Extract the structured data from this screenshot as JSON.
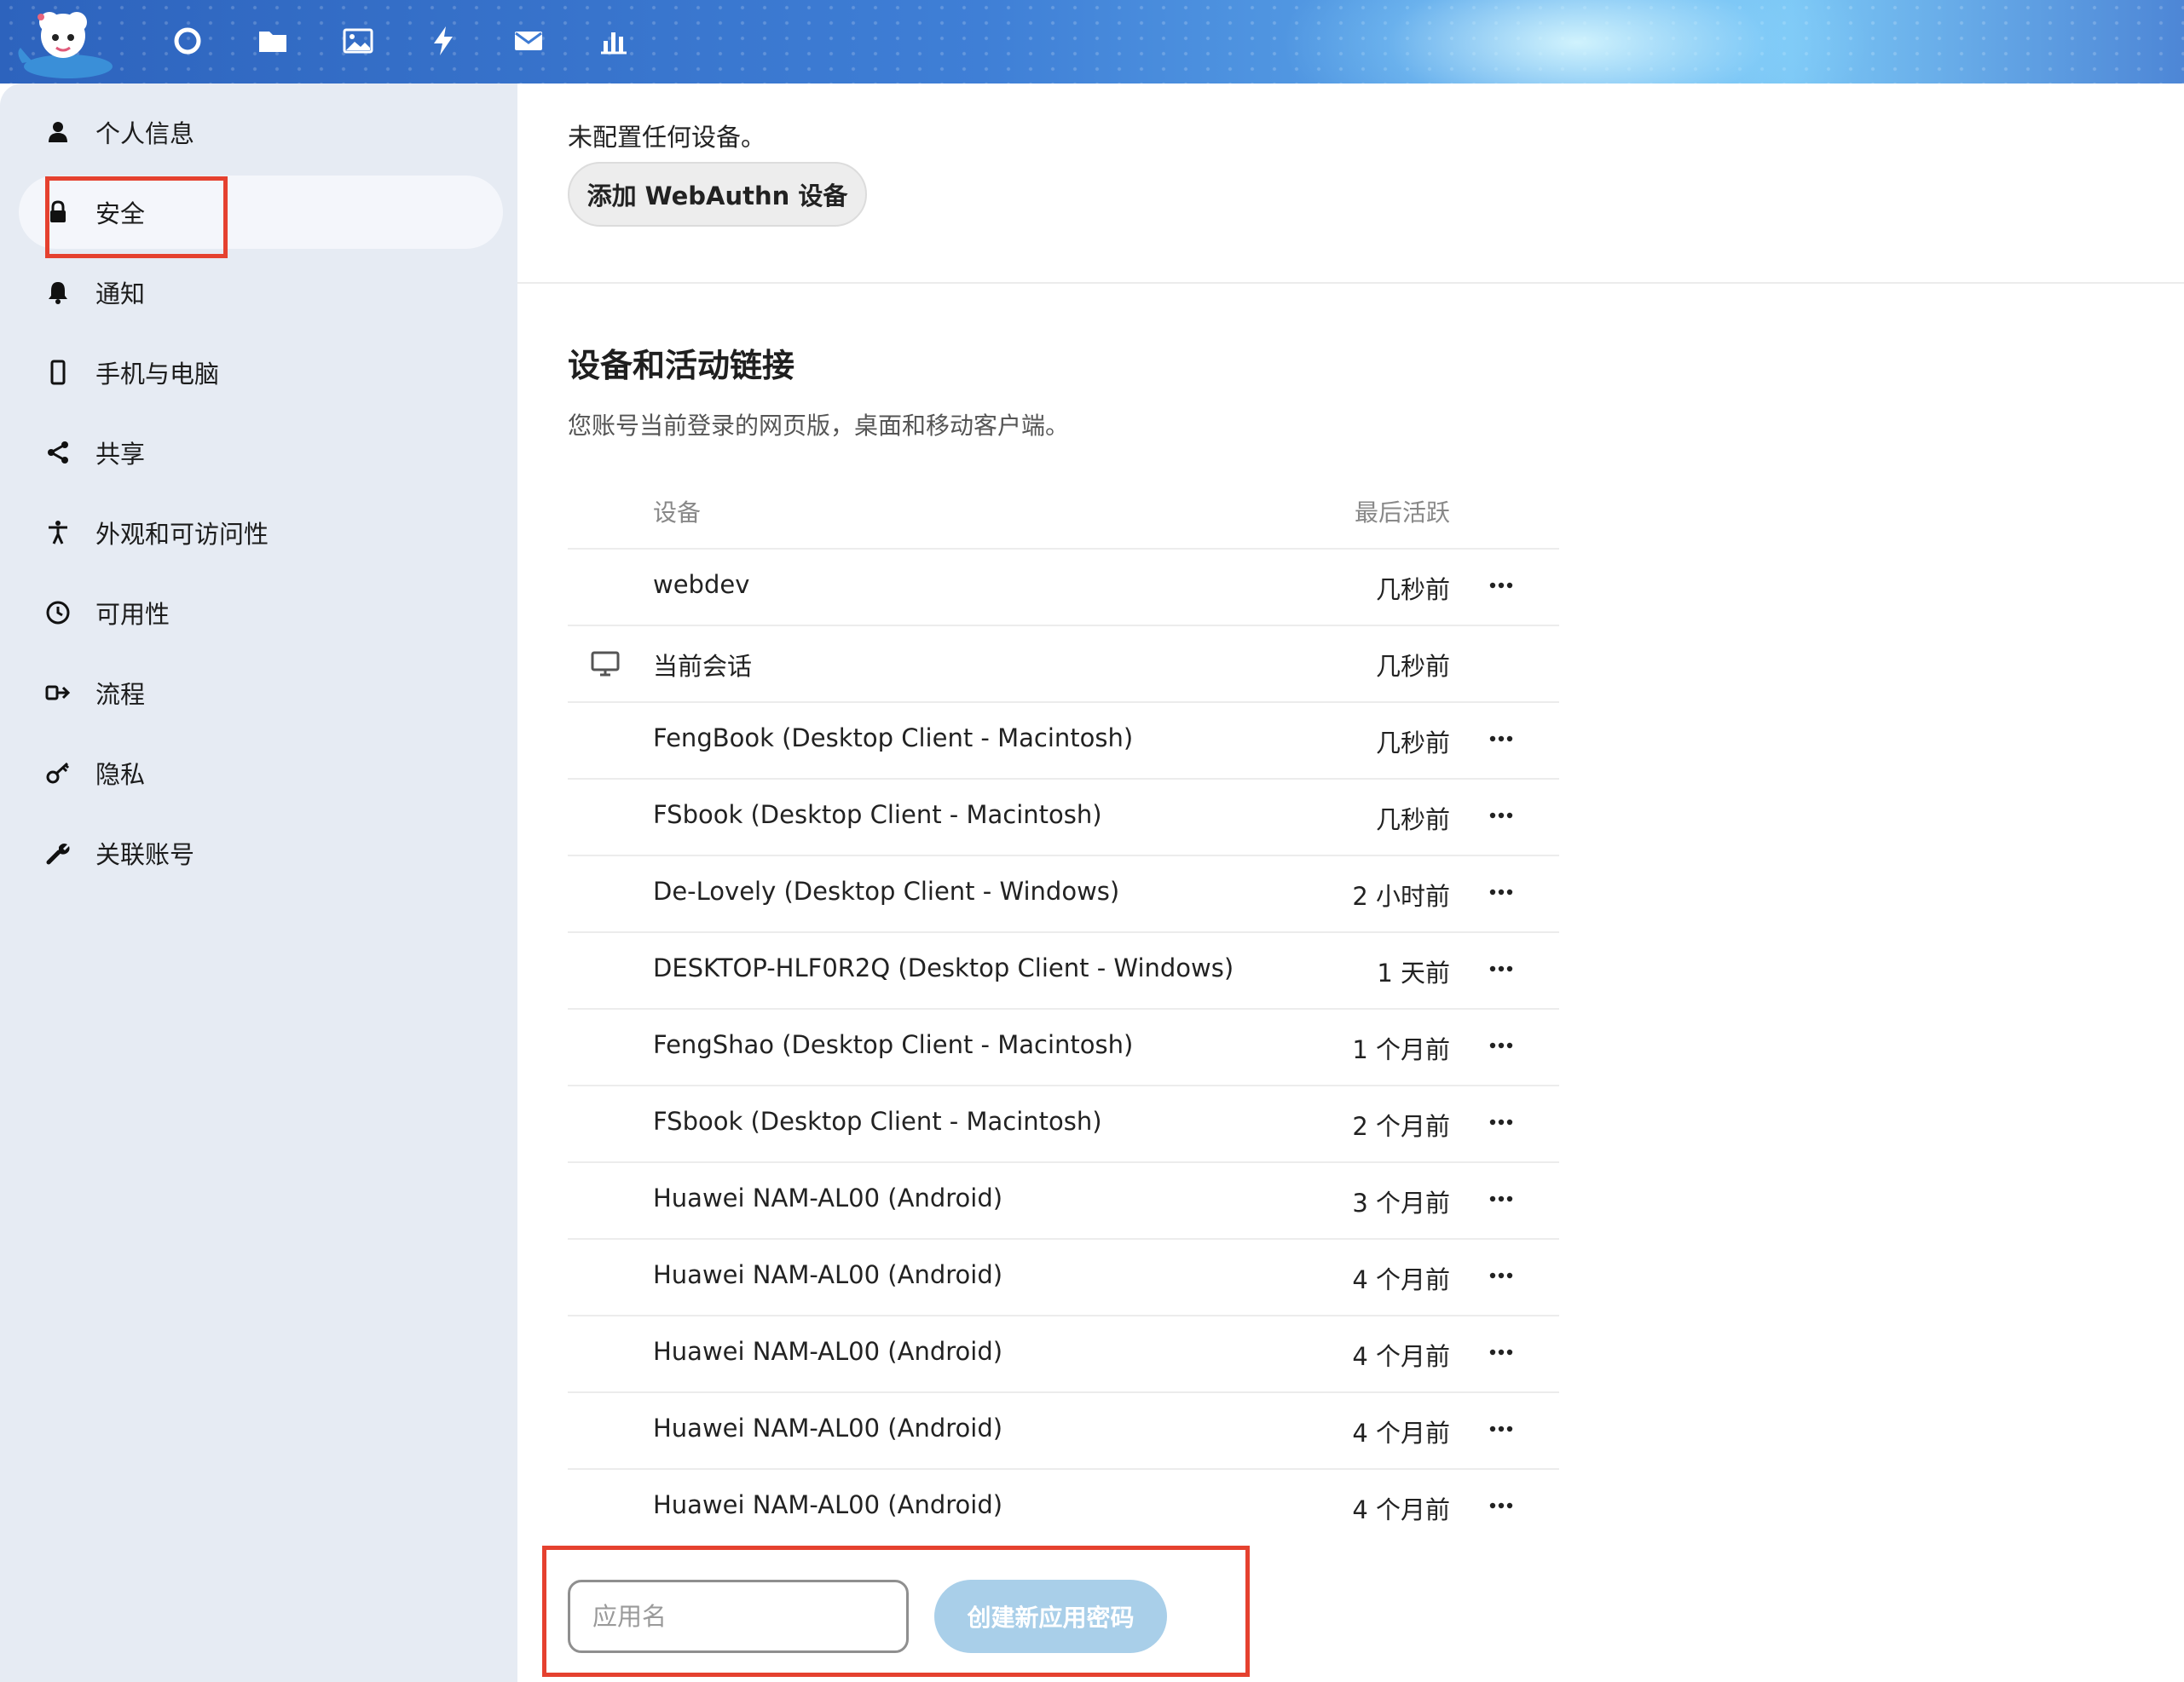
{
  "header": {
    "apps": [
      {
        "name": "dashboard",
        "icon": "circle-icon"
      },
      {
        "name": "files",
        "icon": "folder-icon"
      },
      {
        "name": "photos",
        "icon": "image-icon"
      },
      {
        "name": "activity",
        "icon": "bolt-icon"
      },
      {
        "name": "mail",
        "icon": "mail-icon"
      },
      {
        "name": "analytics",
        "icon": "bar-chart-icon"
      }
    ]
  },
  "sidebar": {
    "items": [
      {
        "label": "个人信息",
        "icon": "user-icon"
      },
      {
        "label": "安全",
        "icon": "lock-icon",
        "active": true
      },
      {
        "label": "通知",
        "icon": "bell-icon"
      },
      {
        "label": "手机与电脑",
        "icon": "phone-icon"
      },
      {
        "label": "共享",
        "icon": "share-icon"
      },
      {
        "label": "外观和可访问性",
        "icon": "accessibility-icon"
      },
      {
        "label": "可用性",
        "icon": "clock-icon"
      },
      {
        "label": "流程",
        "icon": "flow-icon"
      },
      {
        "label": "隐私",
        "icon": "key-icon"
      },
      {
        "label": "关联账号",
        "icon": "wrench-icon"
      }
    ]
  },
  "webauthn": {
    "status": "未配置任何设备。",
    "add_button": "添加 WebAuthn 设备"
  },
  "devices": {
    "title": "设备和活动链接",
    "description": "您账号当前登录的网页版，桌面和移动客户端。",
    "columns": {
      "device": "设备",
      "last_active": "最后活跃"
    },
    "rows": [
      {
        "name": "webdev",
        "time": "几秒前",
        "menu": true
      },
      {
        "name": "当前会话",
        "time": "几秒前",
        "menu": false,
        "icon": "monitor-icon"
      },
      {
        "name": "FengBook (Desktop Client - Macintosh)",
        "time": "几秒前",
        "menu": true
      },
      {
        "name": "FSbook (Desktop Client - Macintosh)",
        "time": "几秒前",
        "menu": true
      },
      {
        "name": "De-Lovely (Desktop Client - Windows)",
        "time": "2 小时前",
        "menu": true
      },
      {
        "name": "DESKTOP-HLF0R2Q (Desktop Client - Windows)",
        "time": "1 天前",
        "menu": true
      },
      {
        "name": "FengShao (Desktop Client - Macintosh)",
        "time": "1 个月前",
        "menu": true
      },
      {
        "name": "FSbook (Desktop Client - Macintosh)",
        "time": "2 个月前",
        "menu": true
      },
      {
        "name": "Huawei NAM-AL00 (Android)",
        "time": "3 个月前",
        "menu": true
      },
      {
        "name": "Huawei NAM-AL00 (Android)",
        "time": "4 个月前",
        "menu": true
      },
      {
        "name": "Huawei NAM-AL00 (Android)",
        "time": "4 个月前",
        "menu": true
      },
      {
        "name": "Huawei NAM-AL00 (Android)",
        "time": "4 个月前",
        "menu": true
      },
      {
        "name": "Huawei NAM-AL00 (Android)",
        "time": "4 个月前",
        "menu": true
      }
    ]
  },
  "app_password": {
    "placeholder": "应用名",
    "create_button": "创建新应用密码"
  },
  "colors": {
    "annotation": "#e5412f",
    "sidebar_bg": "#e6ebf3",
    "primary_light": "#a9cfe9"
  }
}
